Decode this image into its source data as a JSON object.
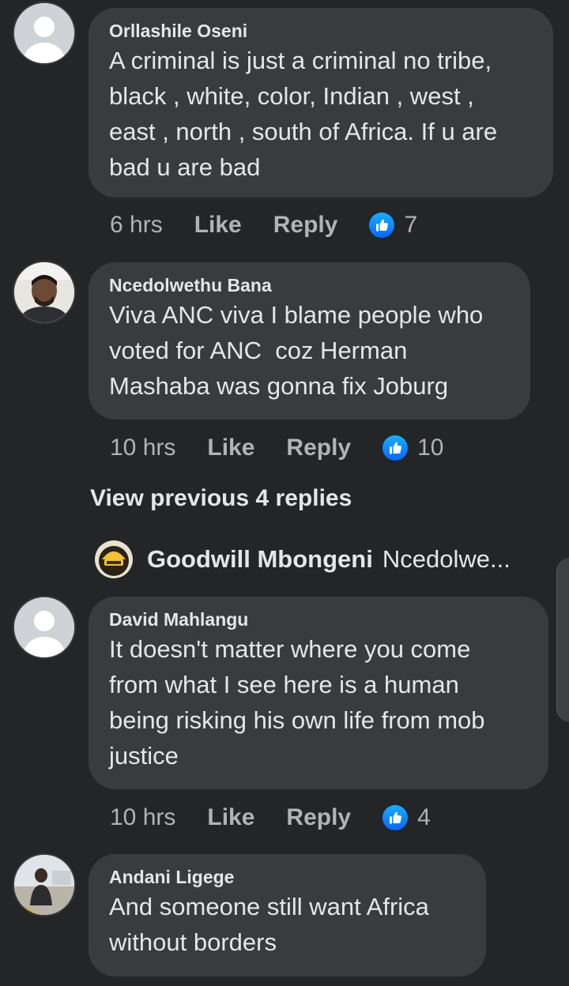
{
  "comments": [
    {
      "author": "Orllashile Oseni",
      "text": "A criminal is just a criminal no tribe,\nblack , white, color, Indian , west ,\neast , north , south of Africa. If u are\nbad u are bad",
      "time": "6 hrs",
      "like_label": "Like",
      "reply_label": "Reply",
      "reaction_count": "7"
    },
    {
      "author": "Ncedolwethu Bana",
      "text": "Viva ANC viva I blame people who\nvoted for ANC  coz Herman\nMashaba was gonna fix Joburg",
      "time": "10 hrs",
      "like_label": "Like",
      "reply_label": "Reply",
      "reaction_count": "10"
    },
    {
      "author": "David Mahlangu",
      "text": "It doesn't matter where you come\nfrom what I see here is a human\nbeing risking his own life from mob\njustice",
      "time": "10 hrs",
      "like_label": "Like",
      "reply_label": "Reply",
      "reaction_count": "4"
    },
    {
      "author": "Andani Ligege",
      "text": "And someone still want Africa\nwithout borders"
    }
  ],
  "view_previous_label": "View previous 4 replies",
  "reply_preview": {
    "author": "Goodwill Mbongeni",
    "snippet": "Ncedolwe..."
  },
  "icons": {
    "reaction": "like-thumb-icon",
    "default_avatar": "default-avatar-icon"
  },
  "colors": {
    "background": "#242526",
    "bubble": "#3a3b3c",
    "primary_text": "#e4e6eb",
    "secondary_text": "#b0b3b8",
    "like_blue": "#0866ff"
  }
}
